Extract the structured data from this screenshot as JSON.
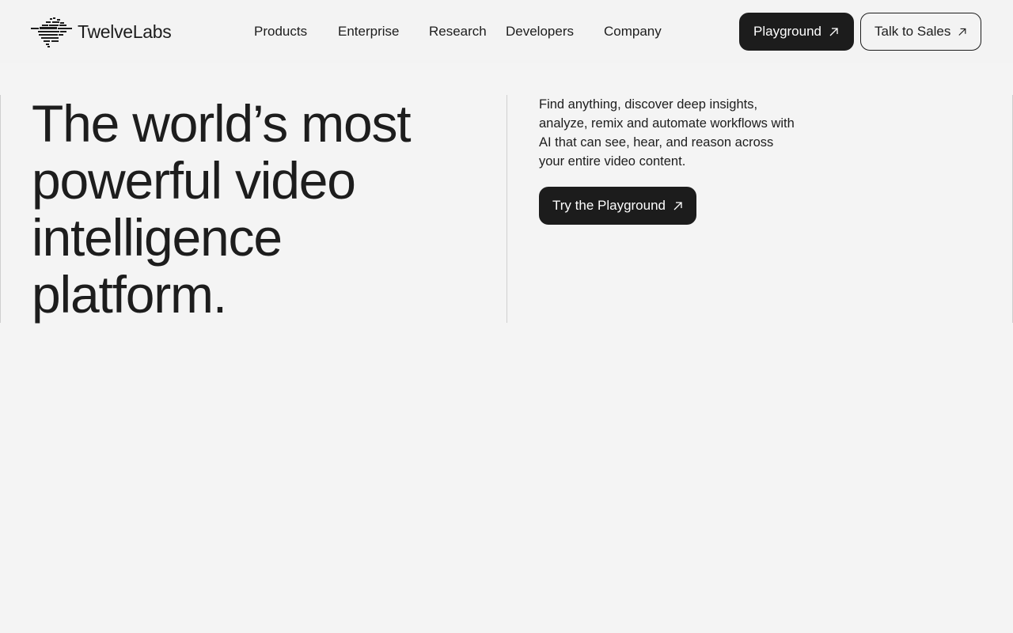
{
  "header": {
    "logo_text": "TwelveLabs",
    "nav": [
      {
        "label": "Products"
      },
      {
        "label": "Enterprise"
      },
      {
        "label": "Research"
      },
      {
        "label": "Developers"
      },
      {
        "label": "Company"
      }
    ],
    "playground_label": "Playground",
    "sales_label": "Talk to Sales"
  },
  "hero": {
    "title_lines": [
      "The world’s most",
      "powerful video",
      "intelligence",
      "platform."
    ],
    "description": "Find anything, discover deep insights, analyze, remix and automate workflows with AI that can see, hear, and reason across your entire video content.",
    "cta_label": "Try the Playground"
  },
  "colors": {
    "background": "#f4f4f4",
    "text": "#1d1d1d",
    "button_dark": "#1c1c1c",
    "divider": "#cfcfcf"
  },
  "icons": {
    "logo": "twelvelabs-logo-icon",
    "arrow": "arrow-up-right-icon"
  }
}
